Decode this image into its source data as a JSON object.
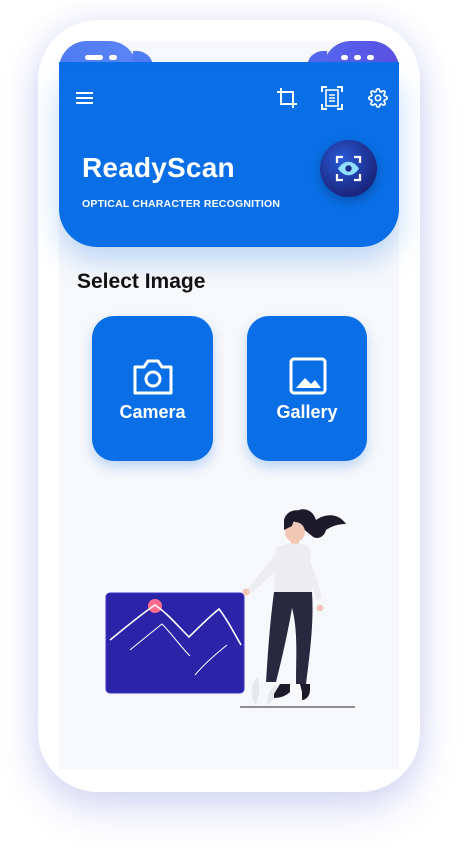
{
  "app": {
    "title": "ReadyScan",
    "subtitle": "OPTICAL CHARACTER RECOGNITION"
  },
  "toolbar": {
    "menu_icon": "menu-icon",
    "crop_icon": "crop-icon",
    "document_scan_icon": "document-scan-icon",
    "settings_icon": "gear-icon"
  },
  "section": {
    "title": "Select Image"
  },
  "actions": [
    {
      "label": "Camera",
      "icon": "camera-icon"
    },
    {
      "label": "Gallery",
      "icon": "image-icon"
    }
  ],
  "colors": {
    "primary": "#0a6fe6",
    "badge_dark": "#19237a",
    "illustration_panel": "#2b24a8"
  }
}
